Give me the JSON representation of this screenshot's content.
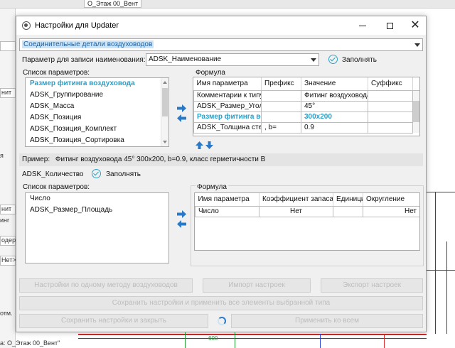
{
  "background": {
    "tab_text": "О_Этаж 00_Вент",
    "left_labels": [
      "нит",
      "я",
      "нит",
      "инг",
      "одер",
      "Нет>",
      "отм."
    ],
    "status_text": "а: О_Этаж 00_Вент\"",
    "plan_label": "600"
  },
  "window": {
    "title": "Настройки для Updater",
    "title_icon": "gear-icon"
  },
  "category_select": {
    "value": "Соединительные детали воздуховодов"
  },
  "name_param": {
    "label": "Параметр для записи наименования:",
    "value": "ADSK_Наименование",
    "fill_label": "Заполнять"
  },
  "top_list": {
    "title": "Список параметров:",
    "items": [
      "Размер фитинга воздуховода",
      "ADSK_Группирование",
      "ADSK_Масса",
      "ADSK_Позиция",
      "ADSK_Позиция_Комплект",
      "ADSK_Позиция_Сортировка"
    ],
    "selected_index": 0
  },
  "top_formula": {
    "title": "Формула",
    "headers": [
      "Имя параметра",
      "Префикс",
      "Значение",
      "Суффикс"
    ],
    "rows": [
      {
        "name": "Комментарии к типу",
        "prefix": "",
        "value": "Фитинг воздуховода",
        "suffix": "",
        "highlight": false
      },
      {
        "name": "ADSK_Размер_УголПоворота",
        "prefix": "",
        "value": "45°",
        "suffix": "",
        "highlight": false
      },
      {
        "name": "Размер фитинга воздуховода",
        "prefix": "",
        "value": "300x200",
        "suffix": "",
        "highlight": true
      },
      {
        "name": "ADSK_Толщина стенки",
        "prefix": ", b=",
        "value": "0.9",
        "suffix": "",
        "highlight": false
      }
    ]
  },
  "example": {
    "label": "Пример:",
    "text": "Фитинг воздуховода 45° 300x200, b=0.9, класс герметичности В"
  },
  "qty_param": {
    "label": "ADSK_Количество",
    "fill_label": "Заполнять"
  },
  "bottom_list": {
    "title": "Список параметров:",
    "items": [
      "Число",
      "ADSK_Размер_Площадь"
    ]
  },
  "bottom_formula": {
    "title": "Формула",
    "headers": [
      "Имя параметра",
      "Коэффициент запаса",
      "Единицы",
      "Округление"
    ],
    "rows": [
      {
        "name": "Число",
        "coef": "Нет",
        "units": "",
        "round": "Нет"
      }
    ]
  },
  "footer_buttons": {
    "settings_all": "Настройки по одному методу воздуховодов",
    "import": "Импорт настроек",
    "export": "Экспорт настроек",
    "save_apply": "Сохранить настройки и применить все элементы выбранной типа",
    "save_close": "Сохранить настройки и закрыть",
    "apply_all": "Применить ко всем"
  }
}
